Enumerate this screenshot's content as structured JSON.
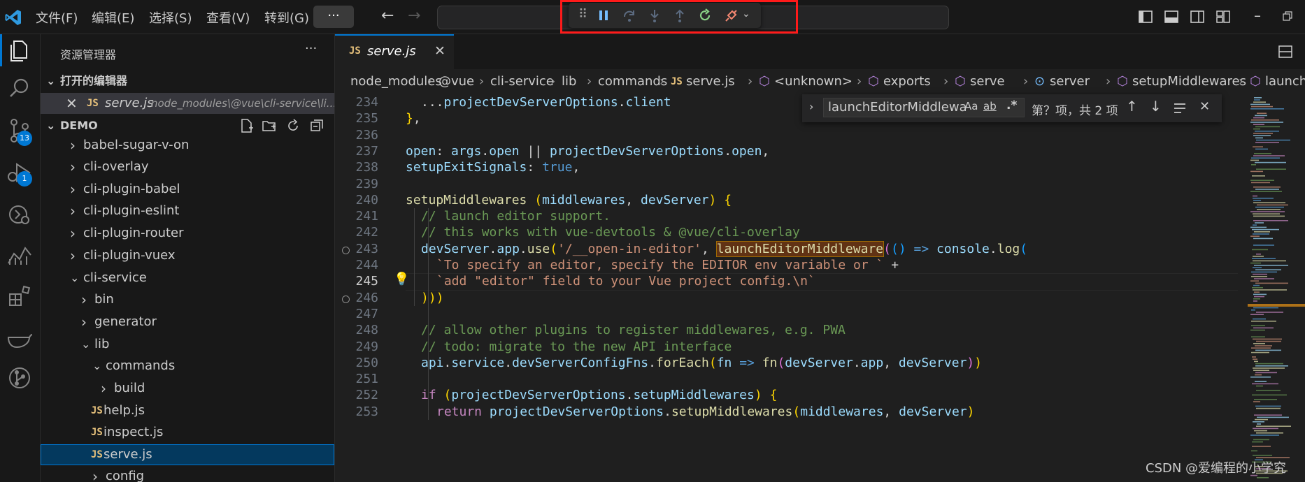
{
  "menu": [
    "文件(F)",
    "编辑(E)",
    "选择(S)",
    "查看(V)",
    "转到(G)"
  ],
  "more_label": "···",
  "sidebar": {
    "title": "资源管理器",
    "open_editors_label": "打开的编辑器",
    "open_editor": {
      "js": "JS",
      "name": "serve.js",
      "path": "node_modules\\@vue\\cli-service\\li..."
    },
    "workspace_label": "DEMO",
    "tree": [
      {
        "label": "babel-sugar-v-on"
      },
      {
        "label": "cli-overlay"
      },
      {
        "label": "cli-plugin-babel"
      },
      {
        "label": "cli-plugin-eslint"
      },
      {
        "label": "cli-plugin-router"
      },
      {
        "label": "cli-plugin-vuex"
      },
      {
        "label": "cli-service"
      },
      {
        "label": "bin"
      },
      {
        "label": "generator"
      },
      {
        "label": "lib"
      },
      {
        "label": "commands"
      },
      {
        "label": "build"
      },
      {
        "label": "help.js"
      },
      {
        "label": "inspect.js"
      },
      {
        "label": "serve.js"
      },
      {
        "label": "config"
      }
    ]
  },
  "activity_badges": {
    "scm": "13",
    "debug": "1"
  },
  "tab": {
    "js": "JS",
    "name": "serve.js"
  },
  "breadcrumbs": [
    "node_modules",
    "@vue",
    "cli-service",
    "lib",
    "commands",
    "serve.js",
    "<unknown>",
    "exports",
    "serve",
    "server",
    "setupMiddlewares",
    "launchEditorMiddleware"
  ],
  "find": {
    "value": "launchEditorMiddlewa",
    "aa": "Aa",
    "ab": "ab",
    "regex": ".*",
    "result": "第？项，共 2 项"
  },
  "line_numbers": [
    "234",
    "235",
    "236",
    "237",
    "238",
    "239",
    "240",
    "241",
    "242",
    "243",
    "244",
    "245",
    "246",
    "247",
    "248",
    "249",
    "250",
    "251",
    "252",
    "253"
  ],
  "current_line": "245",
  "code": [
    "...projectDevServerOptions.client",
    "},",
    "",
    "open: args.open || projectDevServerOptions.open,",
    "setupExitSignals: true,",
    "",
    "setupMiddlewares (middlewares, devServer) {",
    "// launch editor support.",
    "// this works with vue-devtools & @vue/cli-overlay",
    "devServer.app.use('/__open-in-editor', launchEditorMiddleware(() => console.log(",
    "`To specify an editor, specify the EDITOR env variable or ` +",
    "`add \"editor\" field to your Vue project config.\\n`",
    ")))",
    "",
    "// allow other plugins to register middlewares, e.g. PWA",
    "// todo: migrate to the new API interface",
    "api.service.devServerConfigFns.forEach(fn => fn(devServer.app, devServer))",
    "",
    "if (projectDevServerOptions.setupMiddlewares) {",
    "return projectDevServerOptions.setupMiddlewares(middlewares, devServer)"
  ],
  "watermark": "CSDN @爱编程的小学究",
  "colors": {
    "accent": "#0078d4",
    "debug_highlight": "#ff1a1a",
    "match_highlight": "#613214"
  }
}
